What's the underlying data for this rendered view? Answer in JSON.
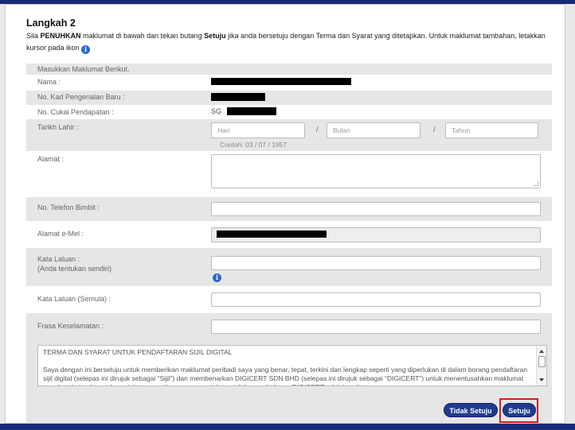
{
  "step_title": "Langkah 2",
  "intro": {
    "p1": "Sila ",
    "b1": "PENUHKAN",
    "p2": " maklumat di bawah dan tekan butang ",
    "b2": "Setuju",
    "p3": " jika anda bersetuju dengan Terma dan Syarat yang ditetapkan. Untuk maklumat tambahan, letakkan kursor pada ikon "
  },
  "info_icon": "i",
  "form": {
    "section_header": "Masukkan Maklumat Berikut.",
    "name_label": "Nama :",
    "ic_label": "No. Kad Pengenalan Baru :",
    "tax_label": "No. Cukai Pendapatan :",
    "tax_prefix": "SG",
    "dob_label": "Tarikh Lahir :",
    "dob_day_placeholder": "Hari",
    "dob_month_placeholder": "Bulan",
    "dob_year_placeholder": "Tahun",
    "dob_separator": "/",
    "dob_hint": "Contoh: 03 / 07 / 1957",
    "address_label": "Alamat :",
    "phone_label": "No. Telefon Bimbit :",
    "email_label": "Alamat e-Mel :",
    "password_label": "Kata Laluan :",
    "password_sub": "(Anda tentukan sendiri)",
    "password_confirm_label": "Kata Laluan (Semula) :",
    "security_phrase_label": "Frasa Keselamatan :"
  },
  "terms": {
    "title": "TERMA DAN SYARAT UNTUK PENDAFTARAN SIJIL DIGITAL",
    "body": "Saya dengan ini bersetuju untuk memberikan maklumat peribadi saya yang benar, tepat, terkini dan lengkap seperti yang diperlukan di dalam borang pendaftaran sijil digital (selepas ini dirujuk sebagai “Sijil”) dan membenarkan DIGICERT SDN BHD (selepas ini dirujuk sebagai “DIGICERT”) untuk menentusahkan maklumat tersebut daripada sumber rujukan yang dianggap sesuai dengan fahaman bahawa DIGICERT adalah terikat"
  },
  "buttons": {
    "disagree": "Tidak Setuju",
    "agree": "Setuju"
  },
  "colors": {
    "brand_navy": "#1f3b8f",
    "highlight_red": "#d31d1d"
  }
}
